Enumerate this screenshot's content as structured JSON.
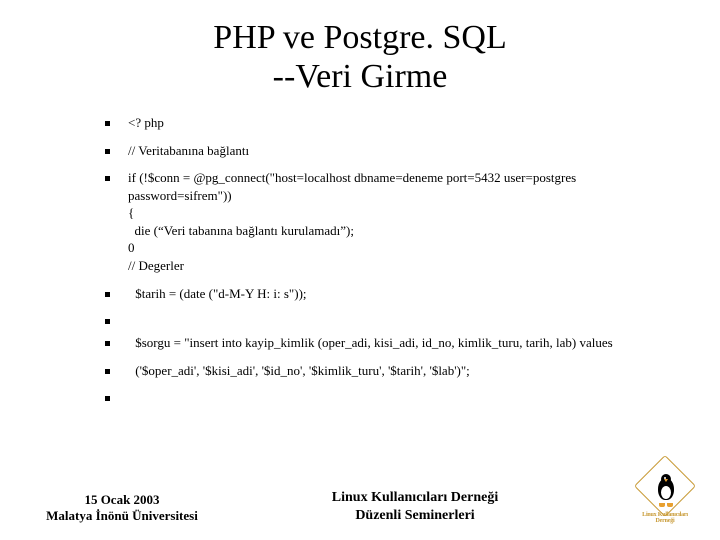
{
  "title_line1": "PHP ve Postgre. SQL",
  "title_line2": "--Veri Girme",
  "bullets": {
    "b0": "<? php",
    "b1": "// Veritabanına bağlantı",
    "b2": "if (!$conn = @pg_connect(\"host=localhost dbname=deneme port=5432 user=postgres password=sifrem\"))\n{\n  die (“Veri tabanına bağlantı kurulamadı”);\n0\n// Degerler",
    "b3": " $tarih = (date (\"d-M-Y H: i: s\"));",
    "b4": "",
    "b5": " $sorgu = \"insert into kayip_kimlik (oper_adi, kisi_adi, id_no, kimlik_turu, tarih, lab) values",
    "b6": " ('$oper_adi', '$kisi_adi', '$id_no', '$kimlik_turu', '$tarih', '$lab')\";",
    "b7": ""
  },
  "footer": {
    "left_line1": "15 Ocak 2003",
    "left_line2": "Malatya İnönü Üniversitesi",
    "center_line1": "Linux Kullanıcıları Derneği",
    "center_line2": "Düzenli Seminerleri",
    "logo_text": "Linux Kullanıcıları Derneği"
  }
}
